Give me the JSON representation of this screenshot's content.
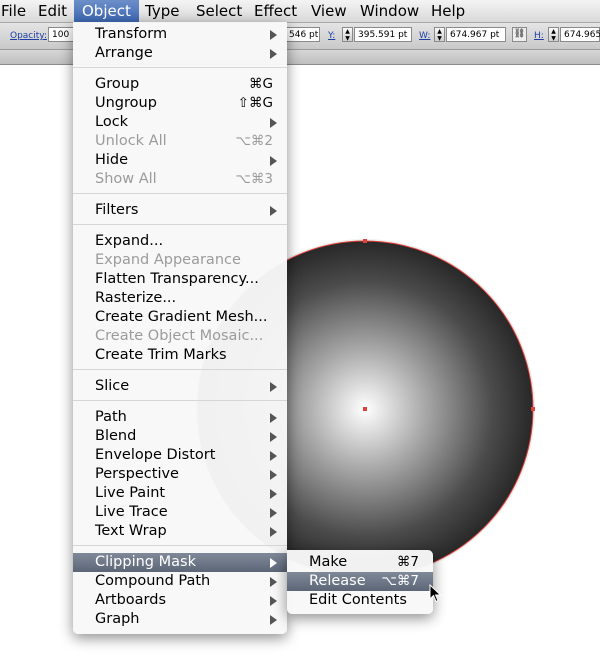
{
  "menubar": {
    "items": [
      "File",
      "Edit",
      "Object",
      "Type",
      "Select",
      "Effect",
      "View",
      "Window",
      "Help"
    ],
    "active": "Object"
  },
  "control_bar": {
    "opacity_label": "Opacity:",
    "opacity_value": "100",
    "x_value_partial": "546 pt",
    "y_label": "Y:",
    "y_value": "395.591 pt",
    "w_label": "W:",
    "w_value": "674.967 pt",
    "h_label": "H:",
    "h_value": "674.965"
  },
  "object_menu": {
    "items": [
      {
        "label": "Transform",
        "shortcut": "",
        "submenu": true,
        "disabled": false
      },
      {
        "label": "Arrange",
        "shortcut": "",
        "submenu": true,
        "disabled": false
      },
      {
        "label": "Group",
        "shortcut": "⌘G",
        "submenu": false,
        "disabled": false
      },
      {
        "label": "Ungroup",
        "shortcut": "⇧⌘G",
        "submenu": false,
        "disabled": false
      },
      {
        "label": "Lock",
        "shortcut": "",
        "submenu": true,
        "disabled": false
      },
      {
        "label": "Unlock All",
        "shortcut": "⌥⌘2",
        "submenu": false,
        "disabled": true
      },
      {
        "label": "Hide",
        "shortcut": "",
        "submenu": true,
        "disabled": false
      },
      {
        "label": "Show All",
        "shortcut": "⌥⌘3",
        "submenu": false,
        "disabled": true
      },
      {
        "label": "Filters",
        "shortcut": "",
        "submenu": true,
        "disabled": false
      },
      {
        "label": "Expand...",
        "shortcut": "",
        "submenu": false,
        "disabled": false
      },
      {
        "label": "Expand Appearance",
        "shortcut": "",
        "submenu": false,
        "disabled": true
      },
      {
        "label": "Flatten Transparency...",
        "shortcut": "",
        "submenu": false,
        "disabled": false
      },
      {
        "label": "Rasterize...",
        "shortcut": "",
        "submenu": false,
        "disabled": false
      },
      {
        "label": "Create Gradient Mesh...",
        "shortcut": "",
        "submenu": false,
        "disabled": false
      },
      {
        "label": "Create Object Mosaic...",
        "shortcut": "",
        "submenu": false,
        "disabled": true
      },
      {
        "label": "Create Trim Marks",
        "shortcut": "",
        "submenu": false,
        "disabled": false
      },
      {
        "label": "Slice",
        "shortcut": "",
        "submenu": true,
        "disabled": false
      },
      {
        "label": "Path",
        "shortcut": "",
        "submenu": true,
        "disabled": false
      },
      {
        "label": "Blend",
        "shortcut": "",
        "submenu": true,
        "disabled": false
      },
      {
        "label": "Envelope Distort",
        "shortcut": "",
        "submenu": true,
        "disabled": false
      },
      {
        "label": "Perspective",
        "shortcut": "",
        "submenu": true,
        "disabled": false
      },
      {
        "label": "Live Paint",
        "shortcut": "",
        "submenu": true,
        "disabled": false
      },
      {
        "label": "Live Trace",
        "shortcut": "",
        "submenu": true,
        "disabled": false
      },
      {
        "label": "Text Wrap",
        "shortcut": "",
        "submenu": true,
        "disabled": false
      },
      {
        "label": "Clipping Mask",
        "shortcut": "",
        "submenu": true,
        "disabled": false,
        "highlighted": true
      },
      {
        "label": "Compound Path",
        "shortcut": "",
        "submenu": true,
        "disabled": false
      },
      {
        "label": "Artboards",
        "shortcut": "",
        "submenu": true,
        "disabled": false
      },
      {
        "label": "Graph",
        "shortcut": "",
        "submenu": true,
        "disabled": false
      }
    ]
  },
  "clipping_submenu": {
    "items": [
      {
        "label": "Make",
        "shortcut": "⌘7"
      },
      {
        "label": "Release",
        "shortcut": "⌥⌘7",
        "highlighted": true
      },
      {
        "label": "Edit Contents",
        "shortcut": ""
      }
    ]
  },
  "colors": {
    "selection": "#e0403a",
    "menu_highlight": "#5c6677",
    "active_menubar": "#3c67b2"
  }
}
